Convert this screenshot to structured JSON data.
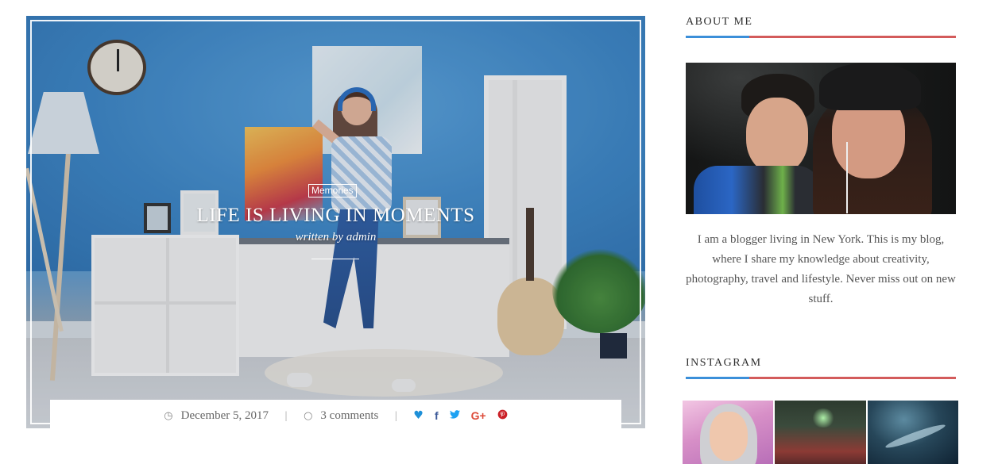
{
  "post": {
    "category": "Memories",
    "title": "LIFE IS LIVING IN MOMENTS",
    "byline": "written by admin",
    "date": "December 5, 2017",
    "comments": "3 comments",
    "icons": {
      "date": "clock-icon",
      "comments": "comment-icon",
      "share": [
        "heart-icon",
        "facebook-icon",
        "twitter-icon",
        "google-plus-icon",
        "pinterest-icon"
      ]
    },
    "share_colors": {
      "heart": "#1e90d8",
      "facebook": "#3b5998",
      "twitter": "#1da1f2",
      "google_plus": "#dd4b39",
      "pinterest": "#cb2027"
    }
  },
  "sidebar": {
    "about": {
      "title": "ABOUT ME",
      "text": "I am a blogger living in New York. This is my blog, where I share my knowledge about creativity, photography, travel and lifestyle. Never miss out on new stuff."
    },
    "instagram": {
      "title": "INSTAGRAM"
    },
    "rule_colors": {
      "accent": "#3b8fd9",
      "main": "#d35b5b"
    }
  }
}
